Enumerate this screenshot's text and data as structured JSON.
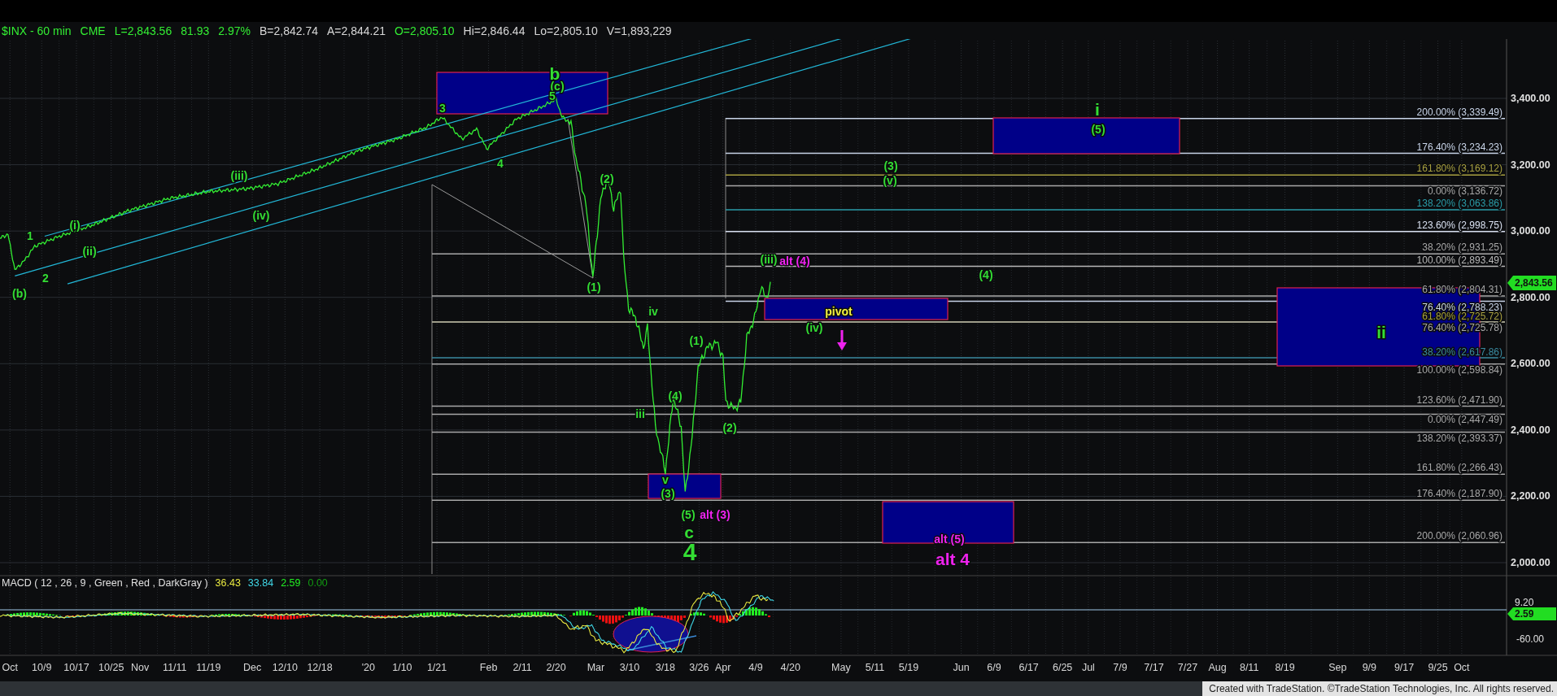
{
  "header": {
    "fields": [
      {
        "text": "$INX - 60 min",
        "color": "#33ee33"
      },
      {
        "text": "CME",
        "color": "#33ee33"
      },
      {
        "text": "L=2,843.56",
        "color": "#33ee33"
      },
      {
        "text": "81.93",
        "color": "#33ee33"
      },
      {
        "text": "2.97%",
        "color": "#33ee33"
      },
      {
        "text": "B=2,842.74",
        "color": "#d8d8d8"
      },
      {
        "text": "A=2,844.21",
        "color": "#d8d8d8"
      },
      {
        "text": "O=2,805.10",
        "color": "#33ee33"
      },
      {
        "text": "Hi=2,846.44",
        "color": "#d8d8d8"
      },
      {
        "text": "Lo=2,805.10",
        "color": "#d8d8d8"
      },
      {
        "text": "V=1,893,229",
        "color": "#d8d8d8"
      }
    ]
  },
  "fib_levels": [
    {
      "label": "200.00% (3,339.49)",
      "color": "#c8d4e8"
    },
    {
      "label": "176.40% (3,234.23)",
      "color": "#c8d4e8"
    },
    {
      "label": "161.80% (3,169.12)",
      "color": "#a8a040"
    },
    {
      "label": "0.00% (3,136.72)",
      "color": "#a8a8a8"
    },
    {
      "label": "138.20% (3,063.86)",
      "color": "#2a9ca8"
    },
    {
      "label": "123.60% (2,998.75)",
      "color": "#d8e0f0"
    },
    {
      "label": "38.20% (2,931.25)",
      "color": "#a8a8a8"
    },
    {
      "label": "100.00% (2,893.49)",
      "color": "#b8b8b8"
    },
    {
      "label": "61.80% (2,804.31)",
      "color": "#a8a8a8"
    },
    {
      "label": "76.40% (2,788.23)",
      "color": "#c8d4e8"
    },
    {
      "label": "61.80% (2,725.72)",
      "color": "#a8a040"
    },
    {
      "label": "76.40% (2,725.78)",
      "color": "#a8a8a8"
    },
    {
      "label": "38.20% (2,617.86)",
      "color": "#3a8aa0"
    },
    {
      "label": "100.00% (2,598.84)",
      "color": "#a8a8a8"
    },
    {
      "label": "123.60% (2,471.90)",
      "color": "#a8a8a8"
    },
    {
      "label": "0.00% (2,447.49)",
      "color": "#a8a8a8"
    },
    {
      "label": "138.20% (2,393.37)",
      "color": "#a8a8a8"
    },
    {
      "label": "161.80% (2,266.43)",
      "color": "#a8a8a8"
    },
    {
      "label": "176.40% (2,187.90)",
      "color": "#a8a8a8"
    },
    {
      "label": "200.00% (2,060.96)",
      "color": "#a8a8a8"
    }
  ],
  "wave_labels": [
    {
      "text": "b",
      "kind": "large",
      "color": "#33dd33"
    },
    {
      "text": "(c)",
      "kind": "small",
      "color": "#33dd33"
    },
    {
      "text": "5",
      "kind": "small",
      "color": "#33dd33"
    },
    {
      "text": "3",
      "kind": "small",
      "color": "#33dd33"
    },
    {
      "text": "i",
      "kind": "large",
      "color": "#33dd33"
    },
    {
      "text": "(5)",
      "kind": "small",
      "color": "#33dd33"
    },
    {
      "text": "4",
      "kind": "small",
      "color": "#33dd33"
    },
    {
      "text": "(3)",
      "kind": "small",
      "color": "#33dd33"
    },
    {
      "text": "(iii)",
      "kind": "small",
      "color": "#33dd33"
    },
    {
      "text": "(2)",
      "kind": "small",
      "color": "#33dd33"
    },
    {
      "text": "(v)",
      "kind": "small",
      "color": "#33dd33"
    },
    {
      "text": "(iv)",
      "kind": "small",
      "color": "#33dd33"
    },
    {
      "text": "(i)",
      "kind": "small",
      "color": "#33dd33"
    },
    {
      "text": "1",
      "kind": "small",
      "color": "#33dd33"
    },
    {
      "text": "(ii)",
      "kind": "small",
      "color": "#33dd33"
    },
    {
      "text": "(iii)",
      "kind": "small",
      "color": "#33dd33"
    },
    {
      "text": "alt (4)",
      "kind": "small",
      "color": "#ee22ee"
    },
    {
      "text": "(4)",
      "kind": "small",
      "color": "#33dd33"
    },
    {
      "text": "2",
      "kind": "small",
      "color": "#33dd33"
    },
    {
      "text": "(1)",
      "kind": "small",
      "color": "#33dd33"
    },
    {
      "text": "(b)",
      "kind": "small",
      "color": "#33dd33"
    },
    {
      "text": "pivot",
      "kind": "small",
      "color": "#f0f040"
    },
    {
      "text": "iv",
      "kind": "small",
      "color": "#33dd33"
    },
    {
      "text": "(iv)",
      "kind": "small",
      "color": "#33dd33"
    },
    {
      "text": "ii",
      "kind": "large",
      "color": "#33dd33"
    },
    {
      "text": "(1)",
      "kind": "small",
      "color": "#33dd33"
    },
    {
      "text": "(4)",
      "kind": "small",
      "color": "#33dd33"
    },
    {
      "text": "iii",
      "kind": "small",
      "color": "#33dd33"
    },
    {
      "text": "(2)",
      "kind": "small",
      "color": "#33dd33"
    },
    {
      "text": "v",
      "kind": "small",
      "color": "#33dd33"
    },
    {
      "text": "(3)",
      "kind": "small",
      "color": "#33dd33"
    },
    {
      "text": "(5)",
      "kind": "small",
      "color": "#33dd33"
    },
    {
      "text": "alt (3)",
      "kind": "small",
      "color": "#ee22ee"
    },
    {
      "text": "c",
      "kind": "large",
      "color": "#33dd33"
    },
    {
      "text": "alt (5)",
      "kind": "small",
      "color": "#ee22ee"
    },
    {
      "text": "4",
      "kind": "xlarge",
      "color": "#33dd33"
    },
    {
      "text": "alt 4",
      "kind": "large",
      "color": "#ee22ee"
    }
  ],
  "price_axis": {
    "ticks": [
      "3,400.00",
      "3,200.00",
      "3,000.00",
      "2,800.00",
      "2,600.00",
      "2,400.00",
      "2,200.00",
      "2,000.00"
    ],
    "last_price": "2,843.56"
  },
  "macd": {
    "title": "MACD ( 12 , 26 , 9 , Green , Red , DarkGray )",
    "values": [
      {
        "text": "36.43",
        "color": "#e8e840"
      },
      {
        "text": "33.84",
        "color": "#40d8e8"
      },
      {
        "text": "2.59",
        "color": "#22ee22"
      },
      {
        "text": "0.00",
        "color": "#119911"
      }
    ],
    "ticks": [
      "9.20",
      "-60.00"
    ],
    "last_value": "2.59"
  },
  "time_axis": {
    "labels": [
      "Oct",
      "10/9",
      "10/17",
      "10/25",
      "Nov",
      "11/11",
      "11/19",
      "Dec",
      "12/10",
      "12/18",
      "'20",
      "1/10",
      "1/21",
      "Feb",
      "2/11",
      "2/20",
      "Mar",
      "3/10",
      "3/18",
      "3/26",
      "Apr",
      "4/9",
      "4/20",
      "May",
      "5/11",
      "5/19",
      "Jun",
      "6/9",
      "6/17",
      "6/25",
      "Jul",
      "7/9",
      "7/17",
      "7/27",
      "Aug",
      "8/11",
      "8/19",
      "Sep",
      "9/9",
      "9/17",
      "9/25",
      "Oct"
    ]
  },
  "footer": "Created with TradeStation. ©TradeStation Technologies, Inc. All rights reserved."
}
